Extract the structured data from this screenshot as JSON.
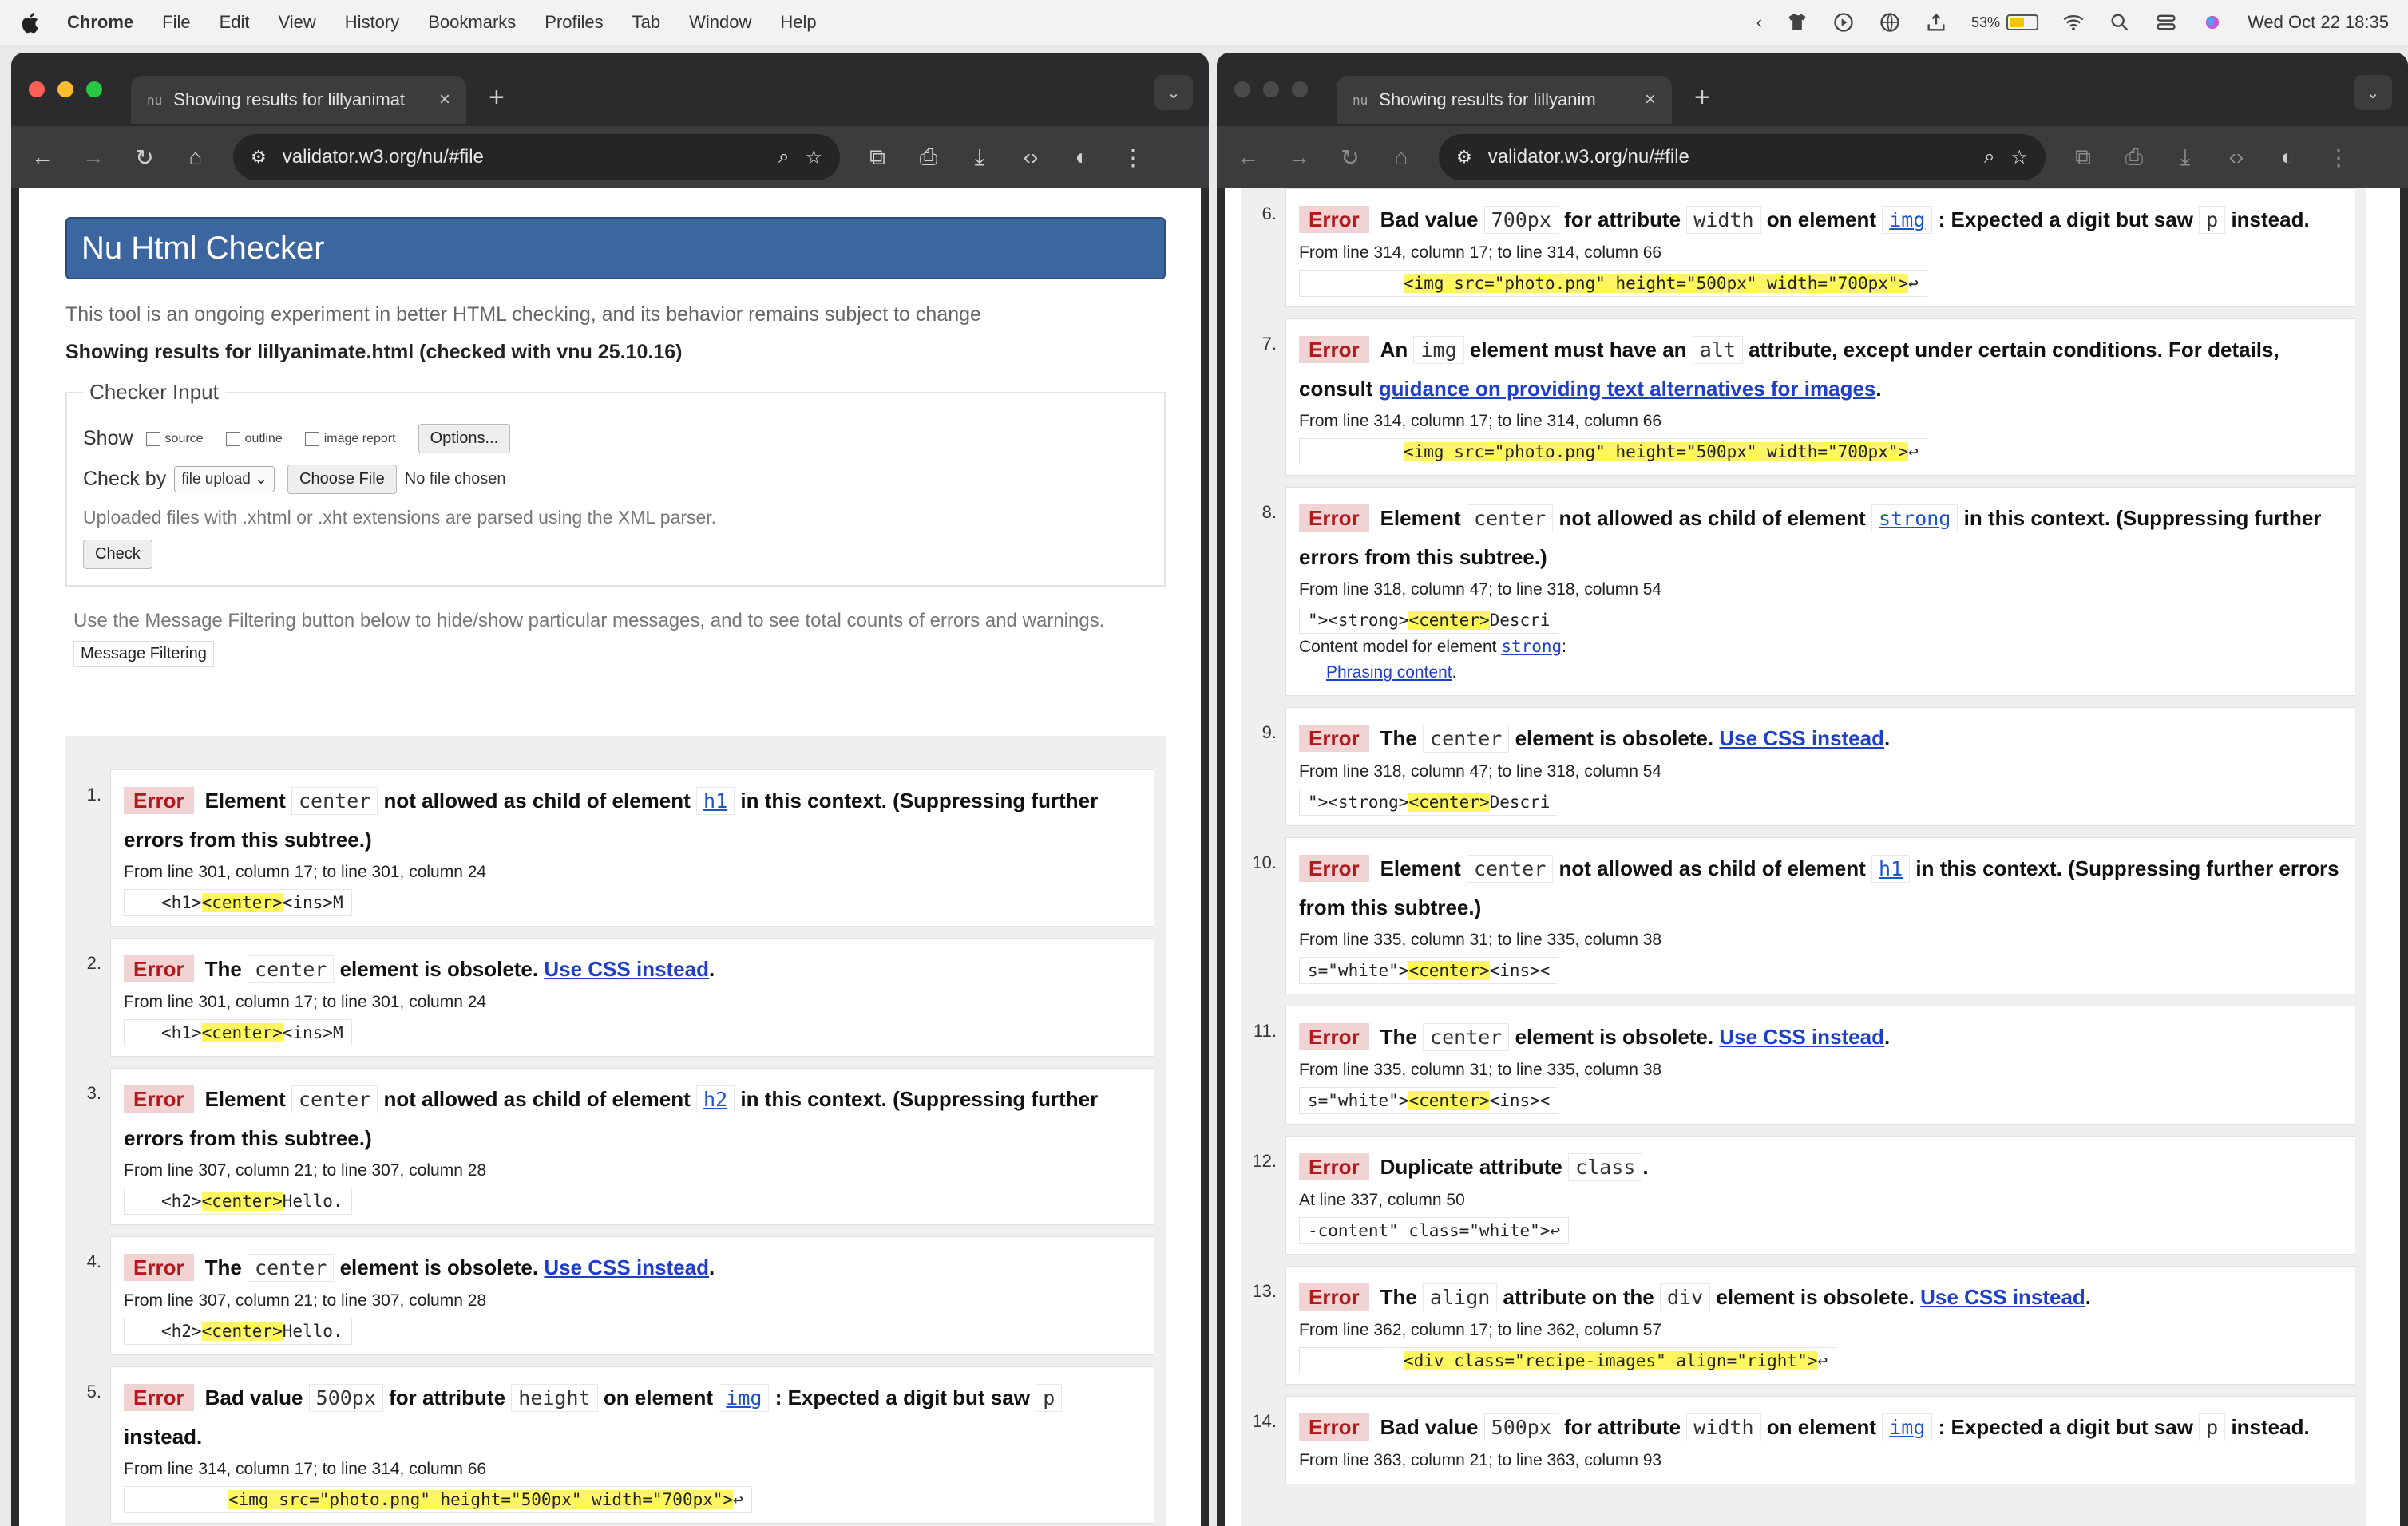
{
  "menubar": {
    "app": "Chrome",
    "items": [
      "File",
      "Edit",
      "View",
      "History",
      "Bookmarks",
      "Profiles",
      "Tab",
      "Window",
      "Help"
    ],
    "battery": "53%",
    "datetime": "Wed Oct 22  18:35"
  },
  "colors": {
    "accent": "#3c66a0",
    "error_bg": "#f2d3d3",
    "error_fg": "#b0191b",
    "highlight": "#fdf65e",
    "link": "#1e3fc9"
  },
  "left": {
    "tab_title": "Showing results for lillyanimat",
    "url": "validator.w3.org/nu/#file",
    "header": "Nu Html Checker",
    "intro": "This tool is an ongoing experiment in better HTML checking, and its behavior remains subject to change",
    "showing": "Showing results for lillyanimate.html (checked with vnu 25.10.16)",
    "checker_input": "Checker Input",
    "show_label": "Show",
    "opt_source": "source",
    "opt_outline": "outline",
    "opt_image": "image report",
    "options_btn": "Options...",
    "checkby_label": "Check by",
    "checkby_value": "file upload",
    "choose_file": "Choose File",
    "no_file": "No file chosen",
    "uploaded_note": "Uploaded files with .xhtml or .xht extensions are parsed using the XML parser.",
    "check_btn": "Check",
    "filter_note": "Use the Message Filtering button below to hide/show particular messages, and to see total counts of errors and warnings.",
    "filter_btn": "Message Filtering"
  },
  "right": {
    "tab_title": "Showing results for lillyanim",
    "url": "validator.w3.org/nu/#file"
  },
  "tab_favicon": "nu",
  "messages": {
    "m1": {
      "num": "1.",
      "err": "Error",
      "a": "Element",
      "c1": "center",
      "b": "not allowed as child of element",
      "c2": "h1",
      "d": "in this context. (Suppressing further errors from this subtree.)",
      "loc": "From line 301, column 17; to line 301, column 24",
      "x1": "<h1>",
      "xh": "<center>",
      "x2": "<ins>M"
    },
    "m2": {
      "num": "2.",
      "err": "Error",
      "a": "The",
      "c1": "center",
      "b": "element is obsolete.",
      "link": "Use CSS instead",
      "end": ".",
      "loc": "From line 301, column 17; to line 301, column 24",
      "x1": "<h1>",
      "xh": "<center>",
      "x2": "<ins>M"
    },
    "m3": {
      "num": "3.",
      "err": "Error",
      "a": "Element",
      "c1": "center",
      "b": "not allowed as child of element",
      "c2": "h2",
      "d": "in this context. (Suppressing further errors from this subtree.)",
      "loc": "From line 307, column 21; to line 307, column 28",
      "x1": "<h2>",
      "xh": "<center>",
      "x2": "Hello."
    },
    "m4": {
      "num": "4.",
      "err": "Error",
      "a": "The",
      "c1": "center",
      "b": "element is obsolete.",
      "link": "Use CSS instead",
      "end": ".",
      "loc": "From line 307, column 21; to line 307, column 28",
      "x1": "<h2>",
      "xh": "<center>",
      "x2": "Hello."
    },
    "m5": {
      "num": "5.",
      "err": "Error",
      "a": "Bad value",
      "c1": "500px",
      "b": "for attribute",
      "c2": "height",
      "c": "on element",
      "c3": "img",
      "d": ": Expected a digit but saw",
      "c4": "p",
      "e": "instead.",
      "loc": "From line 314, column 17; to line 314, column 66",
      "x1": "",
      "xh": "<img src=\"photo.png\" height=\"500px\" width=\"700px\">",
      "x2": "↩"
    },
    "m6": {
      "num": "6.",
      "err": "Error",
      "a": "Bad value",
      "c1": "700px",
      "b": "for attribute",
      "c2": "width",
      "c": "on element",
      "c3": "img",
      "d": ": Expected a digit but saw",
      "c4": "p",
      "e": "instead.",
      "loc": "From line 314, column 17; to line 314, column 66",
      "x1": "",
      "xh": "<img src=\"photo.png\" height=\"500px\" width=\"700px\">",
      "x2": "↩"
    },
    "m7": {
      "num": "7.",
      "err": "Error",
      "a": "An",
      "c1": "img",
      "b": "element must have an",
      "c2": "alt",
      "c": "attribute, except under certain conditions. For details, consult",
      "link": "guidance on providing text alternatives for images",
      "end": ".",
      "loc": "From line 314, column 17; to line 314, column 66",
      "x1": "",
      "xh": "<img src=\"photo.png\" height=\"500px\" width=\"700px\">",
      "x2": "↩"
    },
    "m8": {
      "num": "8.",
      "err": "Error",
      "a": "Element",
      "c1": "center",
      "b": "not allowed as child of element",
      "c2": "strong",
      "d": "in this context. (Suppressing further errors from this subtree.)",
      "loc": "From line 318, column 47; to line 318, column 54",
      "x1": "\"><strong>",
      "xh": "<center>",
      "x2": "Descri",
      "cm_label": "Content model for element",
      "cm_el": "strong",
      "cm_colon": ":",
      "cm_link": "Phrasing content",
      "cm_end": "."
    },
    "m9": {
      "num": "9.",
      "err": "Error",
      "a": "The",
      "c1": "center",
      "b": "element is obsolete.",
      "link": "Use CSS instead",
      "end": ".",
      "loc": "From line 318, column 47; to line 318, column 54",
      "x1": "\"><strong>",
      "xh": "<center>",
      "x2": "Descri"
    },
    "m10": {
      "num": "10.",
      "err": "Error",
      "a": "Element",
      "c1": "center",
      "b": "not allowed as child of element",
      "c2": "h1",
      "d": "in this context. (Suppressing further errors from this subtree.)",
      "loc": "From line 335, column 31; to line 335, column 38",
      "x1": "s=\"white\">",
      "xh": "<center>",
      "x2": "<ins><"
    },
    "m11": {
      "num": "11.",
      "err": "Error",
      "a": "The",
      "c1": "center",
      "b": "element is obsolete.",
      "link": "Use CSS instead",
      "end": ".",
      "loc": "From line 335, column 31; to line 335, column 38",
      "x1": "s=\"white\">",
      "xh": "<center>",
      "x2": "<ins><"
    },
    "m12": {
      "num": "12.",
      "err": "Error",
      "a": "Duplicate attribute",
      "c1": "class",
      "end": ".",
      "loc": "At line 337, column 50",
      "x1": "-content\" class=\"white\">↩"
    },
    "m13": {
      "num": "13.",
      "err": "Error",
      "a": "The",
      "c1": "align",
      "b": "attribute on the",
      "c2": "div",
      "c": "element is obsolete.",
      "link": "Use CSS instead",
      "end": ".",
      "loc": "From line 362, column 17; to line 362, column 57",
      "x1": "",
      "xh": "<div class=\"recipe-images\" align=\"right\">",
      "x2": "↩"
    },
    "m14": {
      "num": "14.",
      "err": "Error",
      "a": "Bad value",
      "c1": "500px",
      "b": "for attribute",
      "c2": "width",
      "c": "on element",
      "c3": "img",
      "d": ": Expected a digit but saw",
      "c4": "p",
      "e": "instead.",
      "loc": "From line 363, column 21; to line 363, column 93"
    }
  }
}
